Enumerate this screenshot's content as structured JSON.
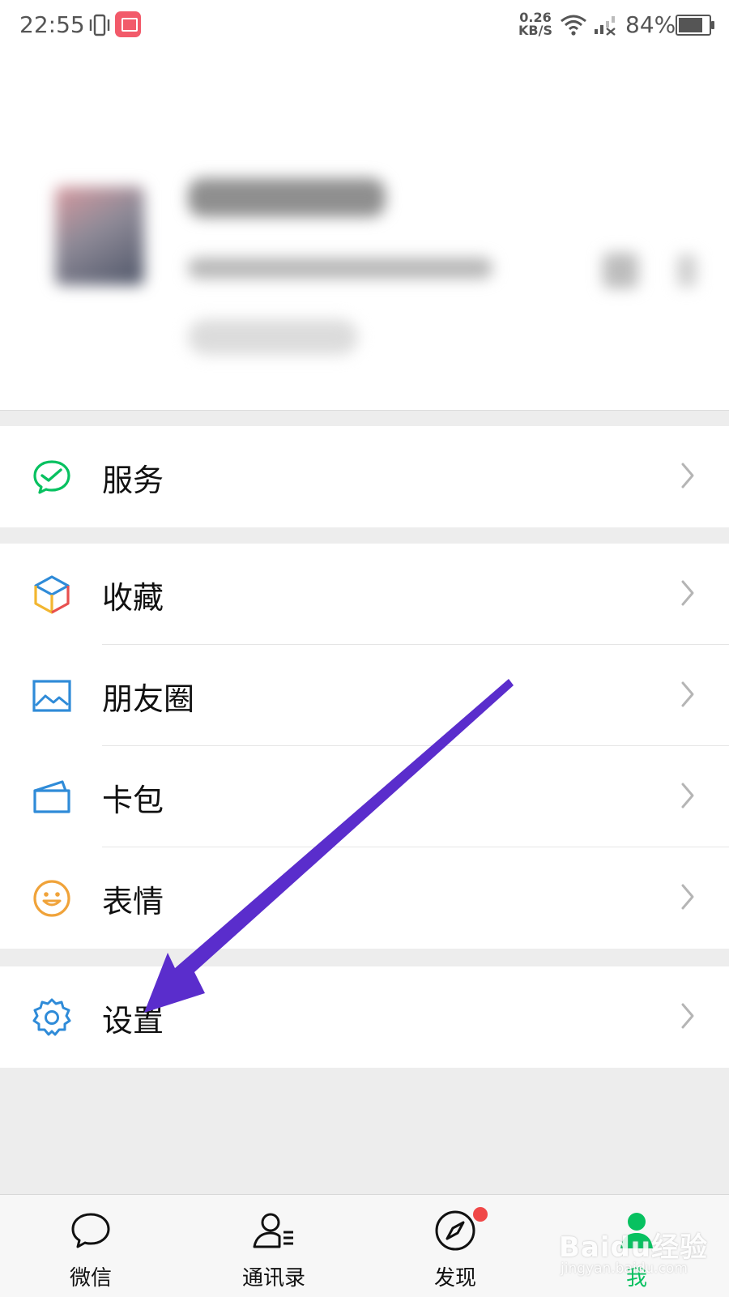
{
  "status_bar": {
    "time": "22:55",
    "net_speed_value": "0.26",
    "net_speed_unit": "KB/S",
    "battery_text": "84%",
    "battery_level": 0.84
  },
  "menu": {
    "service": "服务",
    "favorites": "收藏",
    "moments": "朋友圈",
    "cards": "卡包",
    "stickers": "表情",
    "settings": "设置"
  },
  "tabs": {
    "chats": "微信",
    "contacts": "通讯录",
    "discover": "发现",
    "me": "我"
  },
  "watermark": {
    "brand": "Baidu经验",
    "url": "jingyan.baidu.com"
  },
  "colors": {
    "accent_green": "#07c160",
    "arrow": "#5a2dcc",
    "badge_red": "#f04848"
  }
}
